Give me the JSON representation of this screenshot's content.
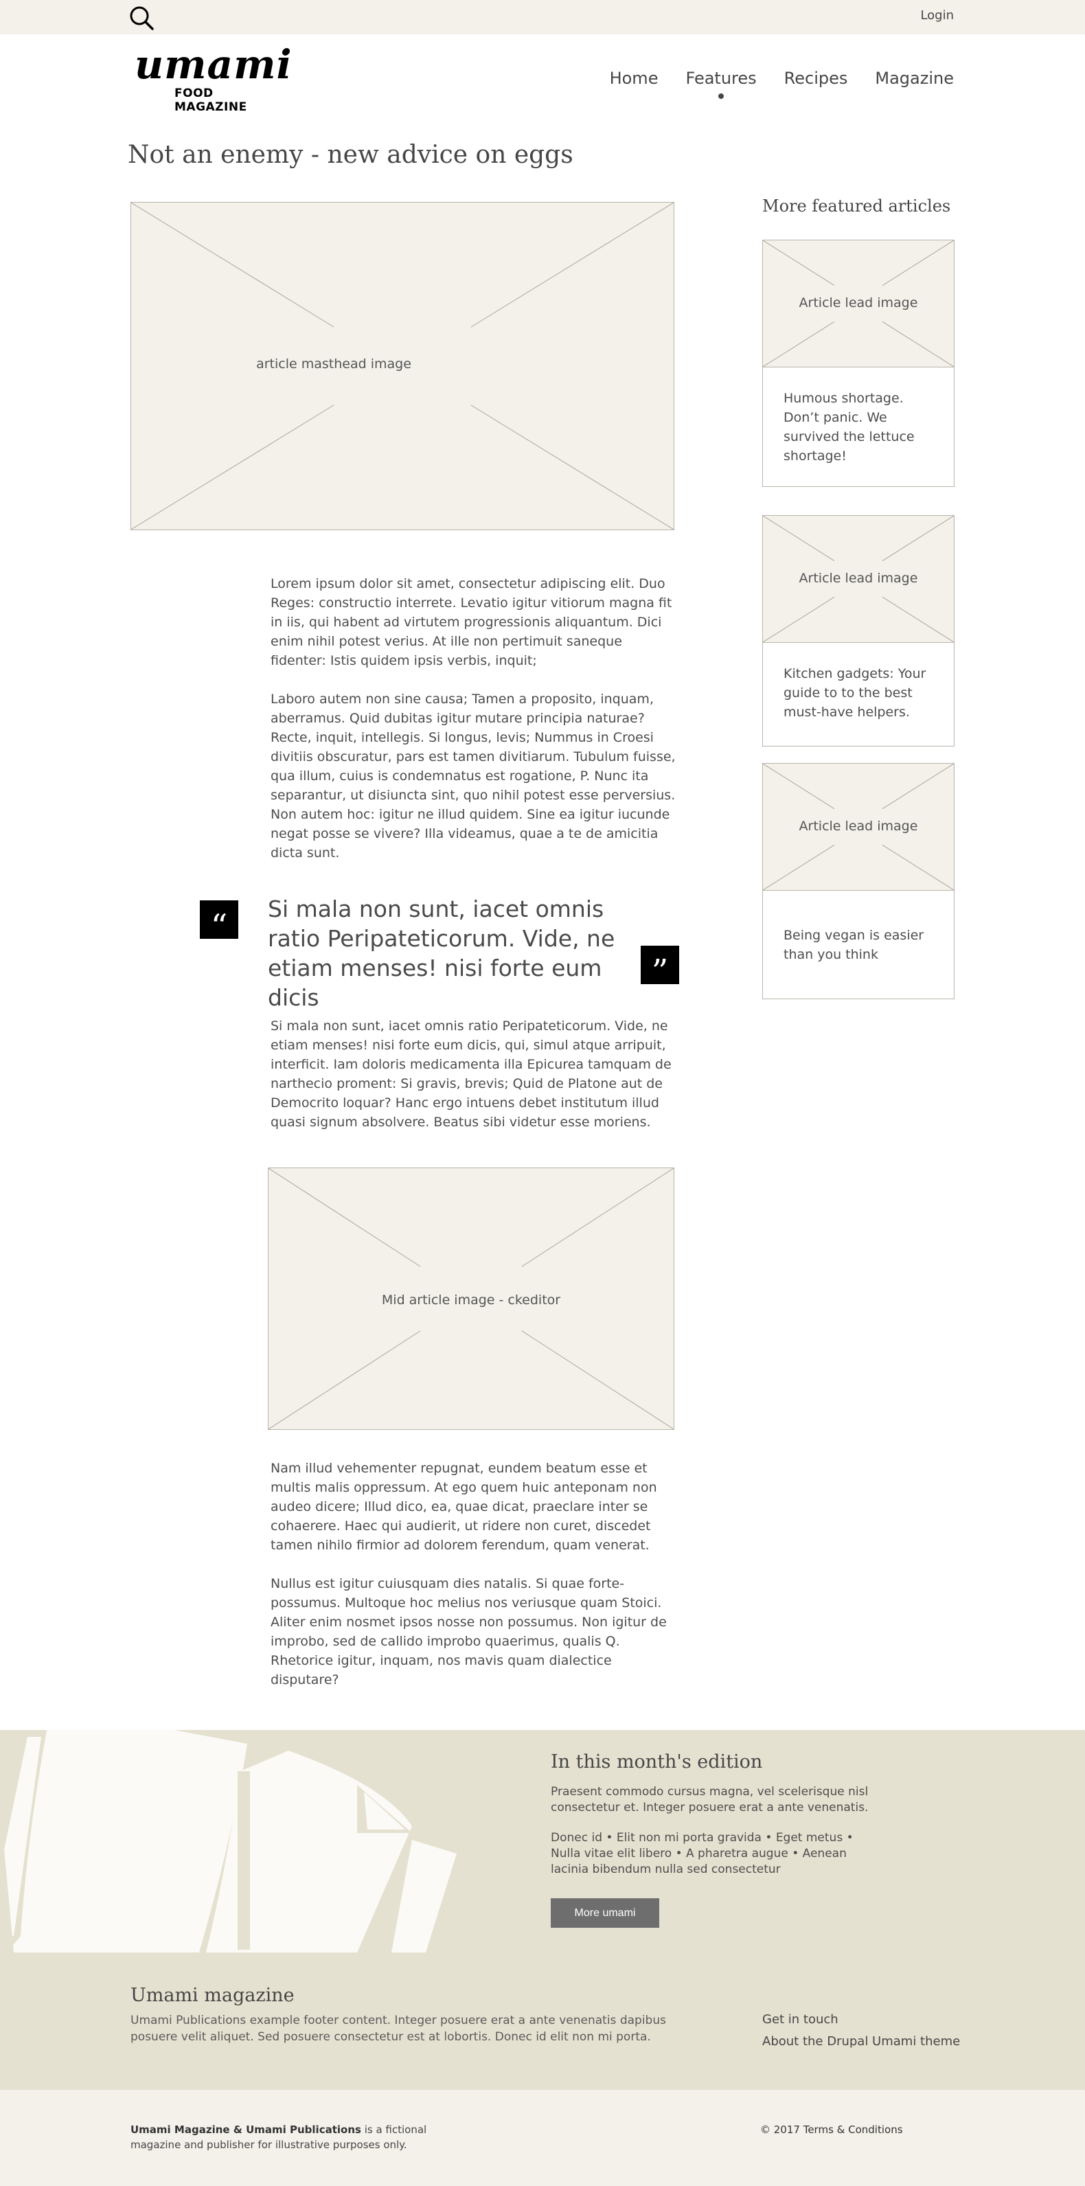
{
  "topbar": {
    "login_label": "Login"
  },
  "header": {
    "logo_word": "umami",
    "logo_sub": "FOOD MAGAZINE",
    "nav": [
      "Home",
      "Features",
      "Recipes",
      "Magazine"
    ],
    "active_nav": "Features"
  },
  "article": {
    "title": "Not an enemy - new advice on eggs",
    "masthead_caption": "article masthead image",
    "paragraphs": [
      "Lorem ipsum dolor sit amet, consectetur adipiscing elit. Duo Reges: constructio interrete. Levatio igitur vitiorum magna fit in iis, qui habent ad virtutem progressionis aliquantum. Dici enim nihil potest verius. At ille non pertimuit saneque fidenter: Istis quidem ipsis verbis, inquit;",
      "Laboro autem non sine causa; Tamen a proposito, inquam, aberramus. Quid dubitas igitur mutare principia naturae? Recte, inquit, intellegis. Si longus, levis; Nummus in Croesi divitiis obscuratur, pars est tamen divitiarum. Tubulum fuisse, qua illum, cuius is condemnatus est rogatione, P. Nunc ita separantur, ut disiuncta sint, quo nihil potest esse perversius. Non autem hoc: igitur ne illud quidem. Sine ea igitur iucunde negat posse se vivere? Illa videamus, quae a te de amicitia dicta sunt.",
      "Si mala non sunt, iacet omnis ratio Peripateticorum. Vide, ne etiam menses! nisi forte eum dicis, qui, simul atque arripuit, interficit. Iam doloris medicamenta illa Epicurea tamquam de narthecio proment: Si gravis, brevis; Quid de Platone aut de Democrito loquar? Hanc ergo intuens debet institutum illud quasi signum absolvere. Beatus sibi videtur esse moriens.",
      "Nam illud vehementer repugnat, eundem beatum esse et multis malis oppressum. At ego quem huic anteponam non audeo dicere; Illud dico, ea, quae dicat, praeclare inter se cohaerere. Haec qui audierit, ut ridere non curet, discedet tamen nihilo firmior ad dolorem ferendum, quam venerat.",
      "Nullus est igitur cuiusquam dies natalis. Si quae forte-possumus. Multoque hoc melius nos veriusque quam Stoici. Aliter enim nosmet ipsos nosse non possumus. Non igitur de improbo, sed de callido improbo quaerimus, qualis Q. Rhetorice igitur, inquam, nos mavis quam dialectice disputare?"
    ],
    "pull_quote": "Si mala non sunt, iacet omnis ratio Peripateticorum. Vide, ne etiam menses! nisi forte eum dicis",
    "quote_open_glyph": "“",
    "quote_close_glyph": "”",
    "mid_image_caption": "Mid article image - ckeditor"
  },
  "sidebar": {
    "title": "More featured articles",
    "cards": [
      {
        "image_caption": "Article lead image",
        "text": "Humous shortage. Don’t panic. We survived the lettuce shortage!"
      },
      {
        "image_caption": "Article lead image",
        "text": "Kitchen gadgets: Your guide to to the best must-have helpers."
      },
      {
        "image_caption": "Article lead image",
        "text": "Being vegan is easier than you think"
      }
    ]
  },
  "promo": {
    "title": "In this month's edition",
    "text1": "Praesent commodo cursus magna, vel scelerisque nisl consectetur et. Integer posuere erat a ante venenatis.",
    "text2": "Donec id • Elit non mi porta gravida • Eget metus • Nulla vitae elit libero • A pharetra augue • Aenean lacinia bibendum nulla sed consectetur",
    "button_label": "More umami"
  },
  "footer": {
    "title": "Umami magazine",
    "text": "Umami Publications example footer content. Integer posuere erat a ante venenatis dapibus posuere velit aliquet. Sed posuere consectetur est at lobortis. Donec id elit non mi porta.",
    "links": [
      "Get in touch",
      "About the Drupal Umami theme"
    ]
  },
  "bottom": {
    "brand": "Umami Magazine & Umami Publications",
    "text": " is a fictional magazine and publisher for illustrative purposes only.",
    "copyright": "© 2017 Terms & Conditions"
  },
  "colors": {
    "topbar_bg": "#f3f1ea",
    "placeholder_bg": "#f3f1ea",
    "promo_bg": "#e5e1d0",
    "button_bg": "#6e6e6e",
    "text": "#464646"
  },
  "icons": [
    "search-icon",
    "quote-open-icon",
    "quote-close-icon"
  ]
}
